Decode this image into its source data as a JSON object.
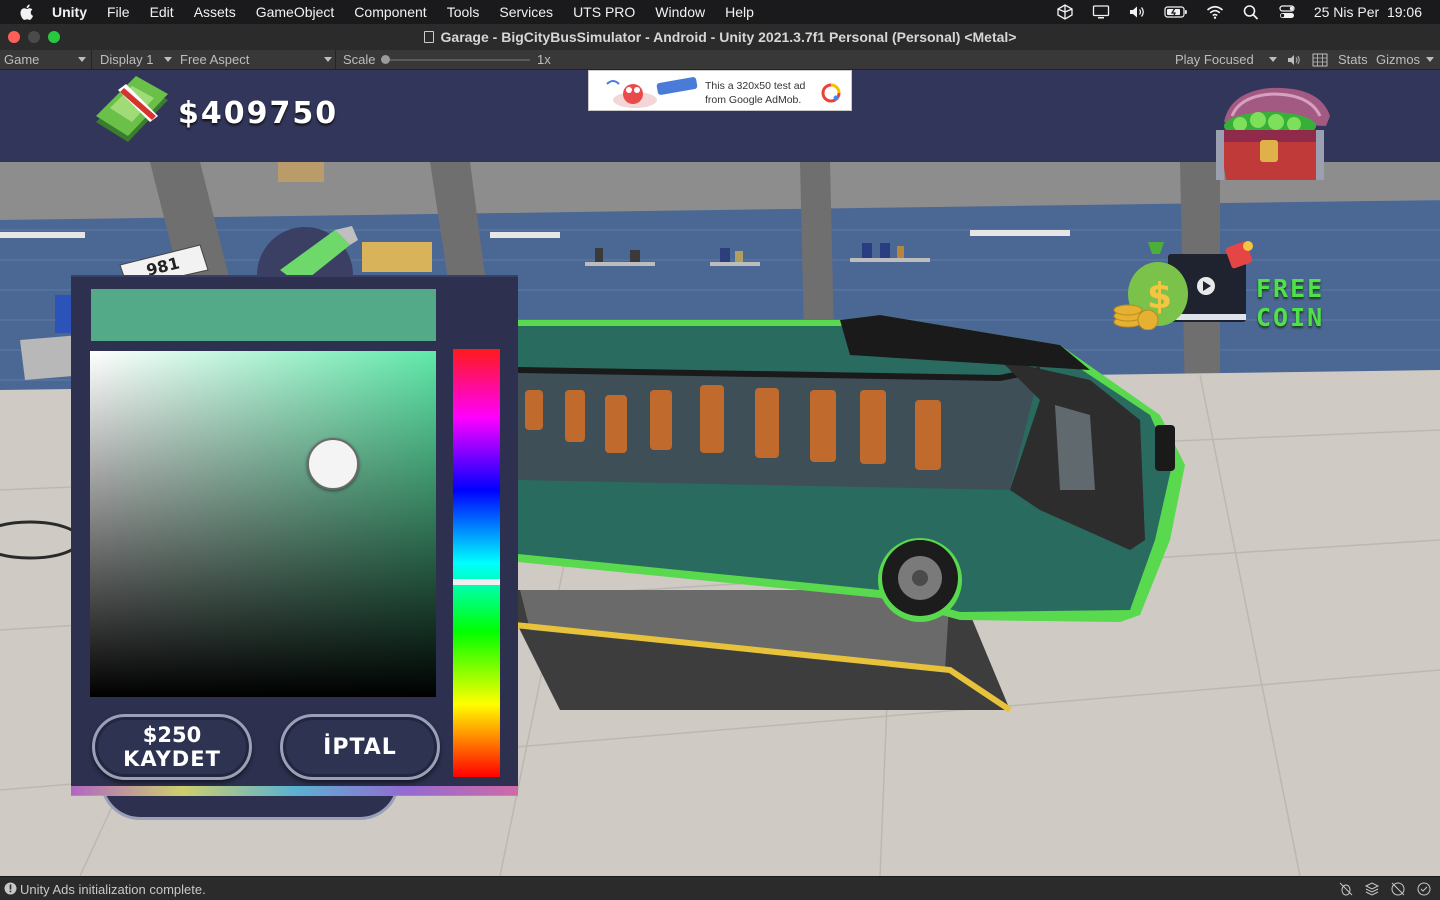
{
  "menubar": {
    "apple_icon": "apple-icon",
    "app_name": "Unity",
    "items": [
      "File",
      "Edit",
      "Assets",
      "GameObject",
      "Component",
      "Tools",
      "Services",
      "UTS PRO",
      "Window",
      "Help"
    ],
    "datetime": "25 Nis Per  19:06"
  },
  "window": {
    "title": "Garage - BigCityBusSimulator - Android - Unity 2021.3.7f1 Personal (Personal) <Metal>",
    "traffic_lights": [
      "#ff5f57",
      "#4a4a4a",
      "#28c840"
    ]
  },
  "game_toolbar": {
    "view_label": "Game",
    "display_label": "Display 1",
    "aspect_label": "Free Aspect",
    "scale_label": "Scale",
    "scale_value": "1x",
    "play_mode_label": "Play Focused",
    "stats_label": "Stats",
    "gizmos_label": "Gizmos"
  },
  "hud": {
    "money": "$409750",
    "ad": {
      "line1": "This a 320x50 test ad",
      "line2": "from Google AdMob."
    },
    "free_coin_label": "FREE COIN"
  },
  "color_picker": {
    "selected_color": "#53aa89",
    "hue_color": "#5fe8a9",
    "save_price": "$250",
    "save_label": "KAYDET",
    "cancel_label": "İPTAL"
  },
  "scene": {
    "license_plate_text": "981"
  },
  "statusbar": {
    "message": "Unity Ads initialization complete."
  }
}
